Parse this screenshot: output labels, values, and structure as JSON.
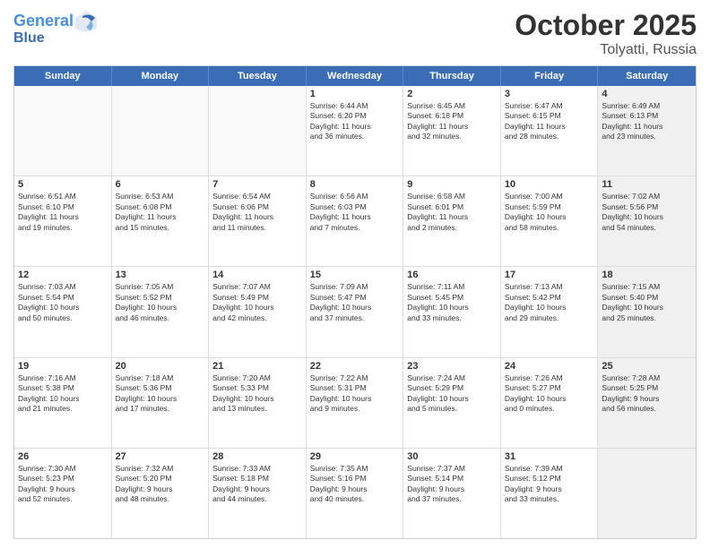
{
  "header": {
    "logo_line1": "General",
    "logo_line2": "Blue",
    "month": "October 2025",
    "location": "Tolyatti, Russia"
  },
  "weekdays": [
    "Sunday",
    "Monday",
    "Tuesday",
    "Wednesday",
    "Thursday",
    "Friday",
    "Saturday"
  ],
  "rows": [
    [
      {
        "day": "",
        "info": "",
        "empty": true
      },
      {
        "day": "",
        "info": "",
        "empty": true
      },
      {
        "day": "",
        "info": "",
        "empty": true
      },
      {
        "day": "1",
        "info": "Sunrise: 6:44 AM\nSunset: 6:20 PM\nDaylight: 11 hours\nand 36 minutes."
      },
      {
        "day": "2",
        "info": "Sunrise: 6:45 AM\nSunset: 6:18 PM\nDaylight: 11 hours\nand 32 minutes."
      },
      {
        "day": "3",
        "info": "Sunrise: 6:47 AM\nSunset: 6:15 PM\nDaylight: 11 hours\nand 28 minutes."
      },
      {
        "day": "4",
        "info": "Sunrise: 6:49 AM\nSunset: 6:13 PM\nDaylight: 11 hours\nand 23 minutes.",
        "shaded": true
      }
    ],
    [
      {
        "day": "5",
        "info": "Sunrise: 6:51 AM\nSunset: 6:10 PM\nDaylight: 11 hours\nand 19 minutes."
      },
      {
        "day": "6",
        "info": "Sunrise: 6:53 AM\nSunset: 6:08 PM\nDaylight: 11 hours\nand 15 minutes."
      },
      {
        "day": "7",
        "info": "Sunrise: 6:54 AM\nSunset: 6:06 PM\nDaylight: 11 hours\nand 11 minutes."
      },
      {
        "day": "8",
        "info": "Sunrise: 6:56 AM\nSunset: 6:03 PM\nDaylight: 11 hours\nand 7 minutes."
      },
      {
        "day": "9",
        "info": "Sunrise: 6:58 AM\nSunset: 6:01 PM\nDaylight: 11 hours\nand 2 minutes."
      },
      {
        "day": "10",
        "info": "Sunrise: 7:00 AM\nSunset: 5:59 PM\nDaylight: 10 hours\nand 58 minutes."
      },
      {
        "day": "11",
        "info": "Sunrise: 7:02 AM\nSunset: 5:56 PM\nDaylight: 10 hours\nand 54 minutes.",
        "shaded": true
      }
    ],
    [
      {
        "day": "12",
        "info": "Sunrise: 7:03 AM\nSunset: 5:54 PM\nDaylight: 10 hours\nand 50 minutes."
      },
      {
        "day": "13",
        "info": "Sunrise: 7:05 AM\nSunset: 5:52 PM\nDaylight: 10 hours\nand 46 minutes."
      },
      {
        "day": "14",
        "info": "Sunrise: 7:07 AM\nSunset: 5:49 PM\nDaylight: 10 hours\nand 42 minutes."
      },
      {
        "day": "15",
        "info": "Sunrise: 7:09 AM\nSunset: 5:47 PM\nDaylight: 10 hours\nand 37 minutes."
      },
      {
        "day": "16",
        "info": "Sunrise: 7:11 AM\nSunset: 5:45 PM\nDaylight: 10 hours\nand 33 minutes."
      },
      {
        "day": "17",
        "info": "Sunrise: 7:13 AM\nSunset: 5:42 PM\nDaylight: 10 hours\nand 29 minutes."
      },
      {
        "day": "18",
        "info": "Sunrise: 7:15 AM\nSunset: 5:40 PM\nDaylight: 10 hours\nand 25 minutes.",
        "shaded": true
      }
    ],
    [
      {
        "day": "19",
        "info": "Sunrise: 7:16 AM\nSunset: 5:38 PM\nDaylight: 10 hours\nand 21 minutes."
      },
      {
        "day": "20",
        "info": "Sunrise: 7:18 AM\nSunset: 5:36 PM\nDaylight: 10 hours\nand 17 minutes."
      },
      {
        "day": "21",
        "info": "Sunrise: 7:20 AM\nSunset: 5:33 PM\nDaylight: 10 hours\nand 13 minutes."
      },
      {
        "day": "22",
        "info": "Sunrise: 7:22 AM\nSunset: 5:31 PM\nDaylight: 10 hours\nand 9 minutes."
      },
      {
        "day": "23",
        "info": "Sunrise: 7:24 AM\nSunset: 5:29 PM\nDaylight: 10 hours\nand 5 minutes."
      },
      {
        "day": "24",
        "info": "Sunrise: 7:26 AM\nSunset: 5:27 PM\nDaylight: 10 hours\nand 0 minutes."
      },
      {
        "day": "25",
        "info": "Sunrise: 7:28 AM\nSunset: 5:25 PM\nDaylight: 9 hours\nand 56 minutes.",
        "shaded": true
      }
    ],
    [
      {
        "day": "26",
        "info": "Sunrise: 7:30 AM\nSunset: 5:23 PM\nDaylight: 9 hours\nand 52 minutes."
      },
      {
        "day": "27",
        "info": "Sunrise: 7:32 AM\nSunset: 5:20 PM\nDaylight: 9 hours\nand 48 minutes."
      },
      {
        "day": "28",
        "info": "Sunrise: 7:33 AM\nSunset: 5:18 PM\nDaylight: 9 hours\nand 44 minutes."
      },
      {
        "day": "29",
        "info": "Sunrise: 7:35 AM\nSunset: 5:16 PM\nDaylight: 9 hours\nand 40 minutes."
      },
      {
        "day": "30",
        "info": "Sunrise: 7:37 AM\nSunset: 5:14 PM\nDaylight: 9 hours\nand 37 minutes."
      },
      {
        "day": "31",
        "info": "Sunrise: 7:39 AM\nSunset: 5:12 PM\nDaylight: 9 hours\nand 33 minutes."
      },
      {
        "day": "",
        "info": "",
        "empty": true,
        "shaded": true
      }
    ]
  ]
}
